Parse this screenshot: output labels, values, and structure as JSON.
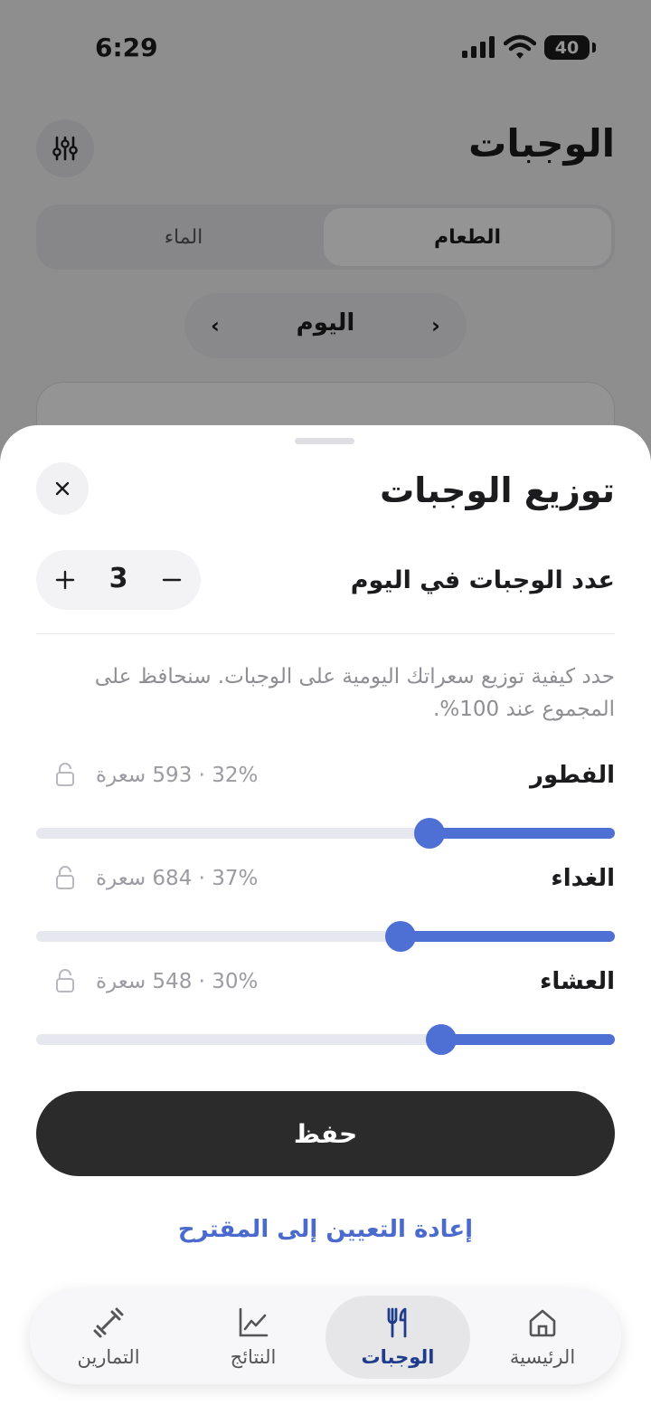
{
  "status_bar": {
    "time": "6:29",
    "battery": "40"
  },
  "background": {
    "title": "الوجبات",
    "segments": {
      "food": "الطعام",
      "water": "الماء"
    },
    "date_label": "اليوم"
  },
  "sheet": {
    "title": "توزيع الوجبات",
    "meal_count_label": "عدد الوجبات في اليوم",
    "meal_count": "3",
    "description": "حدد كيفية توزيع سعراتك اليومية على الوجبات. سنحافظ على المجموع عند 100%.",
    "meals": [
      {
        "name": "الفطور",
        "info": "32% · 593 سعرة",
        "percent": 32
      },
      {
        "name": "الغداء",
        "info": "37% · 684 سعرة",
        "percent": 37
      },
      {
        "name": "العشاء",
        "info": "30% · 548 سعرة",
        "percent": 30
      }
    ],
    "save_label": "حفظ",
    "reset_label": "إعادة التعيين إلى المقترح"
  },
  "tabbar": {
    "items": [
      {
        "label": "الرئيسية",
        "icon": "home-icon"
      },
      {
        "label": "الوجبات",
        "icon": "fork-knife-icon",
        "active": true
      },
      {
        "label": "النتائج",
        "icon": "chart-icon"
      },
      {
        "label": "التمارين",
        "icon": "dumbbell-icon"
      }
    ]
  },
  "colors": {
    "accent": "#4e6fd4",
    "link": "#4a6bcd",
    "primary_button": "#2b2b2b",
    "active_tab_text": "#1f3c8c"
  }
}
